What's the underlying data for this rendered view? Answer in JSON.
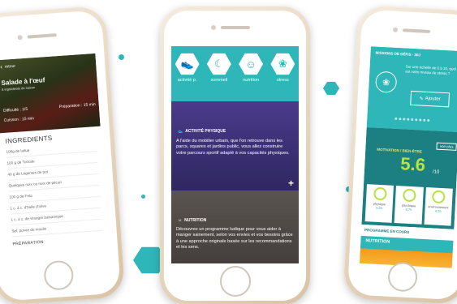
{
  "colors": {
    "teal": "#2fb6b8",
    "dark_teal": "#1c7f82",
    "lime": "#b6e33f",
    "purple": "#3a2f72",
    "gold": "#e7d6bf"
  },
  "left_phone": {
    "top_label": "retour",
    "title": "Salade à l'œuf",
    "subtitle": "8 ingrédients de saison",
    "difficulty": "Difficulté : 1/5",
    "prep_time": "Préparation : 15 min",
    "cook_time": "Cuisson : 15 min",
    "section": "INGREDIENTS",
    "ingredients": [
      "100g de laitue",
      "100 g de Tomate",
      "40 g de Légumes de pot",
      "Quelques noix ou noix de pécan",
      "100 g de Feta",
      "1 c. à c. d'huile d'olive",
      "1 c. à c. de vinaigre balsamique",
      "Sel, poivre du moulin"
    ],
    "footer": "PRÉPARATION"
  },
  "middle_phone": {
    "tabs": [
      {
        "label": "activité p.",
        "icon": "shoe-icon"
      },
      {
        "label": "sommeil",
        "icon": "moon-icon"
      },
      {
        "label": "nutrition",
        "icon": "nutrition-icon"
      },
      {
        "label": "stress",
        "icon": "lotus-icon"
      }
    ],
    "cards": [
      {
        "heading": "ACTIVITÉ PHYSIQUE",
        "text": "A l'aide du mobilier urbain, que l'on retrouve dans les parcs, squares et jardins public, vous allez construire votre parcours sportif adapté à vos capacités physiques."
      },
      {
        "heading": "NUTRITION",
        "text": "Découvrez un programme ludique pour vous aider à manger sainement, selon vos envies et vos besoins grâce à une approche originale basée sur les recommandations et les sens."
      }
    ]
  },
  "right_phone": {
    "header": "MISSIONS DE DÉFIS - 30J",
    "question": "Sur une échelle de 0 à 10, quel est votre niveau de stress ?",
    "button": "Ajouter",
    "score_label": "MOTIVATION / BIEN-ÊTRE",
    "see_more": "voir plus",
    "score": "5.6",
    "score_max": "/10",
    "subscores": [
      {
        "name": "physique",
        "value": "5.65"
      },
      {
        "name": "psychique",
        "value": "6.75"
      },
      {
        "name": "environnement",
        "value": "4.25"
      }
    ],
    "program_label": "PROGRAMME EN COURS",
    "program": "NUTRITION"
  }
}
